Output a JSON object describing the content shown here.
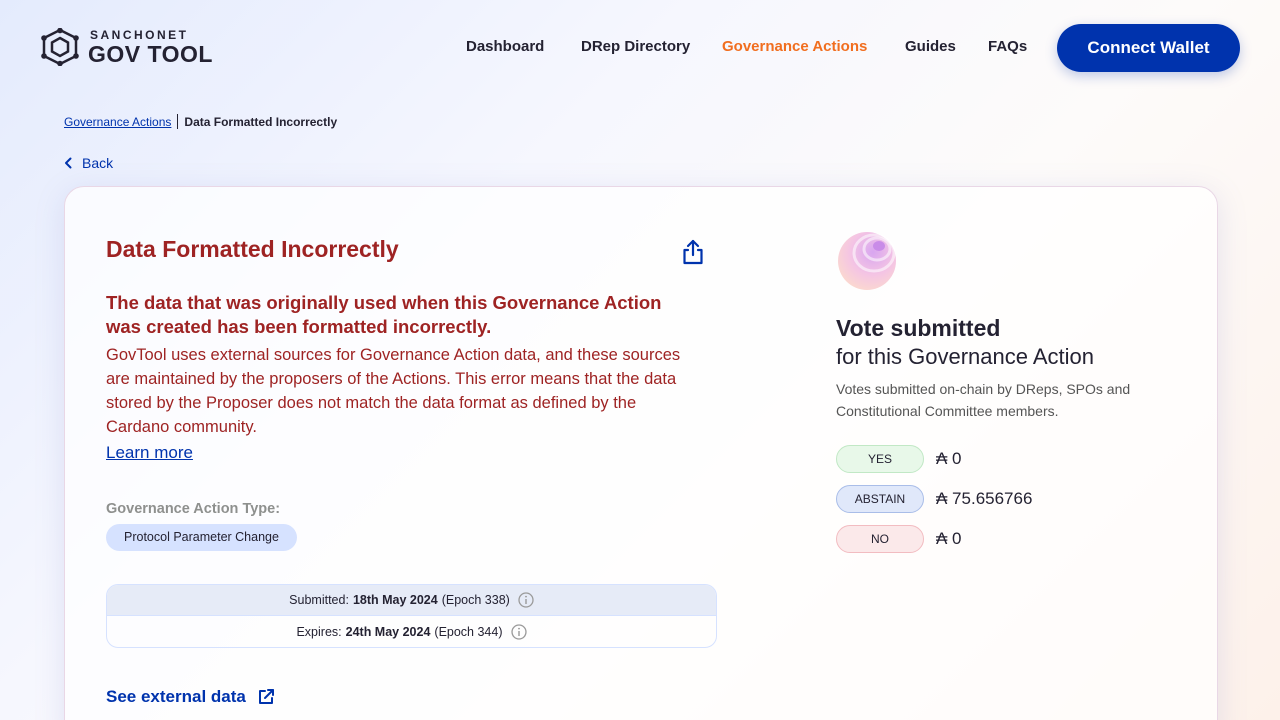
{
  "header": {
    "logo_sub": "SANCHONET",
    "logo_main": "GOV TOOL",
    "nav": [
      {
        "label": "Dashboard"
      },
      {
        "label": "DRep Directory"
      },
      {
        "label": "Governance Actions",
        "active": true
      },
      {
        "label": "Guides"
      },
      {
        "label": "FAQs"
      }
    ],
    "connect_label": "Connect Wallet"
  },
  "breadcrumb": {
    "parent": "Governance Actions",
    "current": "Data Formatted Incorrectly"
  },
  "back_label": "Back",
  "action": {
    "title": "Data Formatted Incorrectly",
    "error_heading": "The data that was originally used when this Governance Action was created has been formatted incorrectly.",
    "error_body": "GovTool uses external sources for Governance Action data, and these sources are maintained by the proposers of the Actions. This error means that the data stored by the Proposer does not match the data format as defined by the Cardano community.",
    "learn_more": "Learn more",
    "type_label": "Governance Action Type:",
    "type_value": "Protocol Parameter Change",
    "submitted_label": "Submitted:",
    "submitted_date": "18th May 2024",
    "submitted_epoch": "(Epoch 338)",
    "expires_label": "Expires:",
    "expires_date": "24th May 2024",
    "expires_epoch": "(Epoch 344)",
    "external_link": "See external data"
  },
  "votes": {
    "title": "Vote submitted",
    "subtitle": "for this Governance Action",
    "description": "Votes submitted on-chain by DReps, SPOs and Constitutional Committee members.",
    "rows": [
      {
        "label": "YES",
        "value": "₳ 0"
      },
      {
        "label": "ABSTAIN",
        "value": "₳ 75.656766"
      },
      {
        "label": "NO",
        "value": "₳ 0"
      }
    ]
  },
  "colors": {
    "accent": "#0033ad",
    "active_nav": "#f16e1f",
    "error": "#9e2323"
  }
}
